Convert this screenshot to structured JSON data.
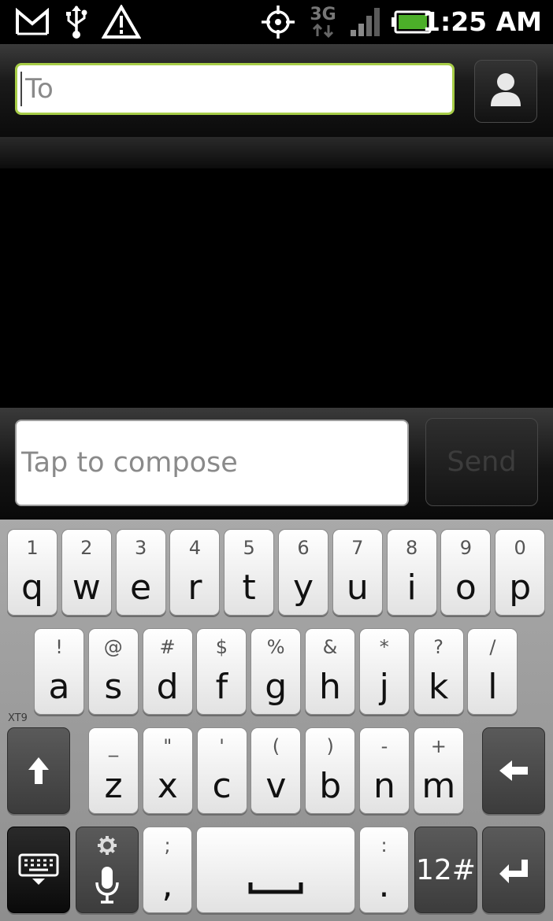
{
  "status_bar": {
    "time": "1:25 AM",
    "network_type": "3G",
    "icons": [
      "gmail-icon",
      "usb-icon",
      "warning-icon",
      "gps-icon",
      "network-3g-icon",
      "signal-icon",
      "battery-icon"
    ]
  },
  "recipient": {
    "placeholder": "To"
  },
  "compose": {
    "placeholder": "Tap to compose",
    "send_label": "Send"
  },
  "keyboard": {
    "mode_label": "XT9",
    "row1": [
      {
        "hint": "1",
        "char": "q"
      },
      {
        "hint": "2",
        "char": "w"
      },
      {
        "hint": "3",
        "char": "e"
      },
      {
        "hint": "4",
        "char": "r"
      },
      {
        "hint": "5",
        "char": "t"
      },
      {
        "hint": "6",
        "char": "y"
      },
      {
        "hint": "7",
        "char": "u"
      },
      {
        "hint": "8",
        "char": "i"
      },
      {
        "hint": "9",
        "char": "o"
      },
      {
        "hint": "0",
        "char": "p"
      }
    ],
    "row2": [
      {
        "hint": "!",
        "char": "a"
      },
      {
        "hint": "@",
        "char": "s"
      },
      {
        "hint": "#",
        "char": "d"
      },
      {
        "hint": "$",
        "char": "f"
      },
      {
        "hint": "%",
        "char": "g"
      },
      {
        "hint": "&",
        "char": "h"
      },
      {
        "hint": "*",
        "char": "j"
      },
      {
        "hint": "?",
        "char": "k"
      },
      {
        "hint": "/",
        "char": "l"
      }
    ],
    "row3": [
      {
        "hint": "_",
        "char": "z"
      },
      {
        "hint": "\"",
        "char": "x"
      },
      {
        "hint": "'",
        "char": "c"
      },
      {
        "hint": "(",
        "char": "v"
      },
      {
        "hint": ")",
        "char": "b"
      },
      {
        "hint": "-",
        "char": "n"
      },
      {
        "hint": "+",
        "char": "m"
      }
    ],
    "row4": {
      "comma_hint": ";",
      "comma_char": ",",
      "period_hint": ":",
      "period_char": ".",
      "symbols_label": "12#"
    }
  },
  "colors": {
    "to_field_border": "#a7cd47",
    "battery_fill": "#4caf29",
    "keyboard_bg": "#9b9b9b",
    "key_face": "#f2f2f2"
  }
}
